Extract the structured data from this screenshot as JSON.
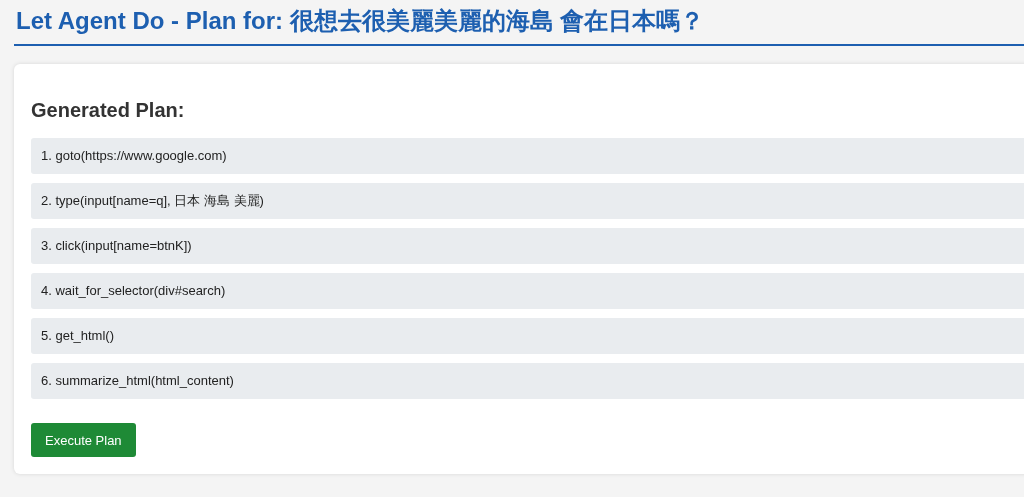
{
  "title": "Let Agent Do - Plan for: 很想去很美麗美麗的海島 會在日本嗎？",
  "plan": {
    "heading": "Generated Plan:",
    "steps": [
      "1. goto(https://www.google.com)",
      "2. type(input[name=q], 日本 海島 美麗)",
      "3. click(input[name=btnK])",
      "4. wait_for_selector(div#search)",
      "5. get_html()",
      "6. summarize_html(html_content)"
    ],
    "button": "Execute Plan"
  }
}
